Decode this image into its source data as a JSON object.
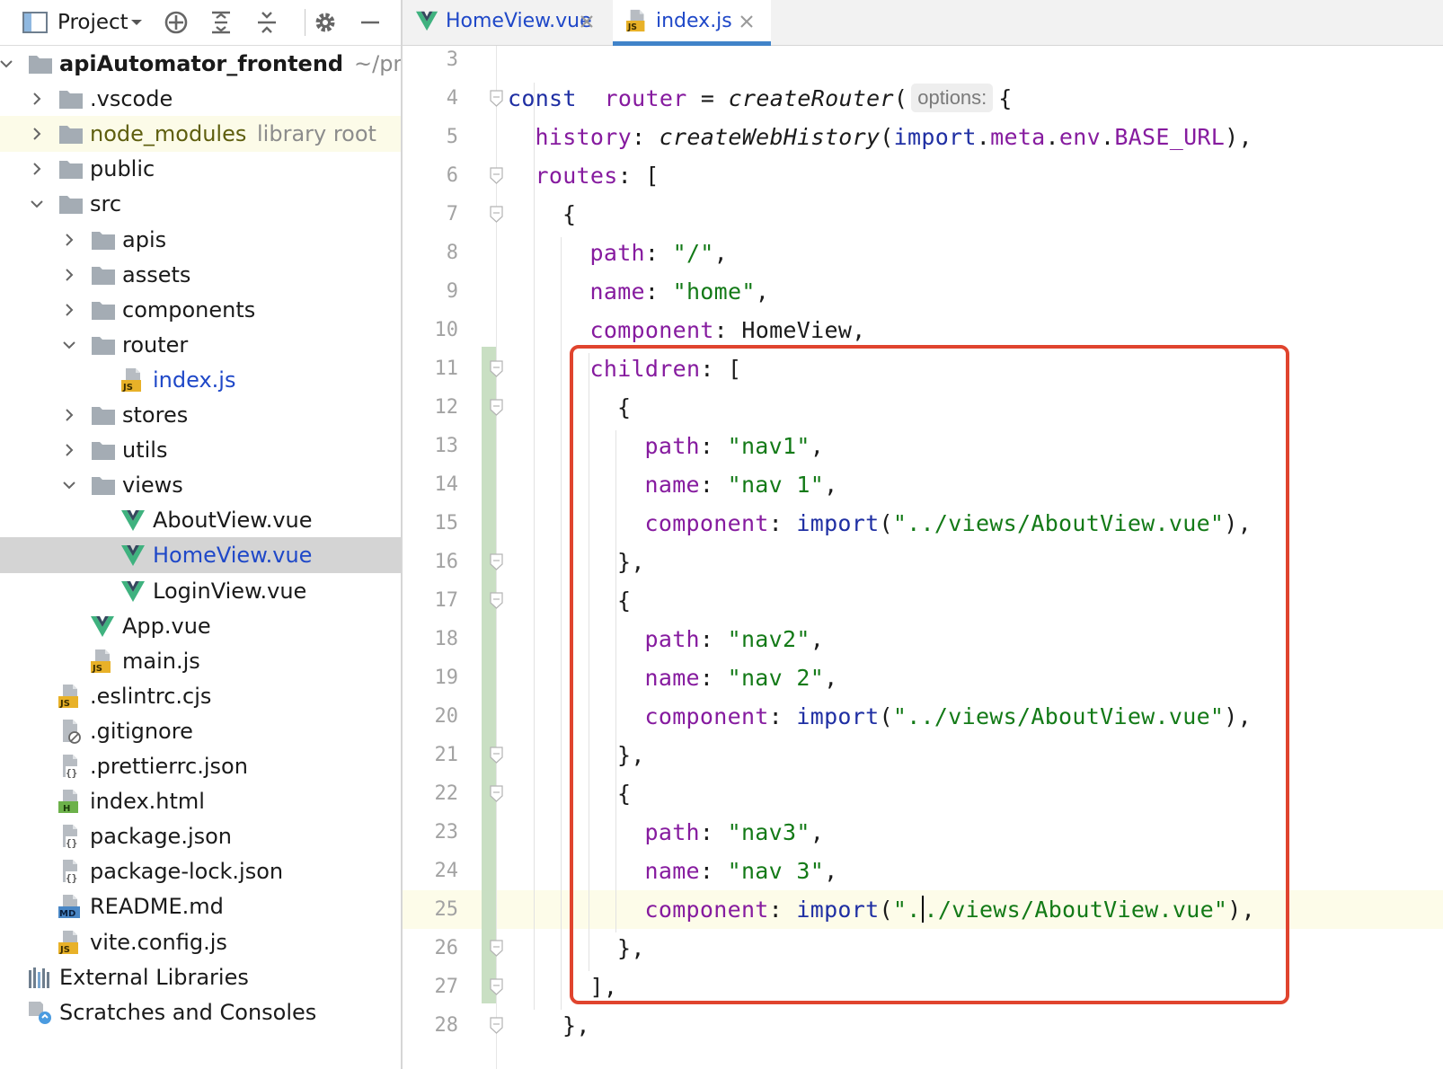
{
  "project_panel": {
    "title": "Project",
    "tree": [
      {
        "label": "apiAutomator_frontend",
        "hint": "~/projects/apiAutomator_frontend",
        "type": "folder",
        "depth": 0,
        "expanded": true,
        "bold": true
      },
      {
        "label": ".vscode",
        "type": "folder",
        "depth": 1,
        "expanded": false
      },
      {
        "label": "node_modules",
        "hint": "library root",
        "type": "folder",
        "depth": 1,
        "expanded": false,
        "library": true
      },
      {
        "label": "public",
        "type": "folder",
        "depth": 1,
        "expanded": false
      },
      {
        "label": "src",
        "type": "folder",
        "depth": 1,
        "expanded": true
      },
      {
        "label": "apis",
        "type": "folder",
        "depth": 2,
        "expanded": false
      },
      {
        "label": "assets",
        "type": "folder",
        "depth": 2,
        "expanded": false
      },
      {
        "label": "components",
        "type": "folder",
        "depth": 2,
        "expanded": false
      },
      {
        "label": "router",
        "type": "folder",
        "depth": 2,
        "expanded": true
      },
      {
        "label": "index.js",
        "type": "js",
        "depth": 3,
        "color": "blue"
      },
      {
        "label": "stores",
        "type": "folder",
        "depth": 2,
        "expanded": false
      },
      {
        "label": "utils",
        "type": "folder",
        "depth": 2,
        "expanded": false
      },
      {
        "label": "views",
        "type": "folder",
        "depth": 2,
        "expanded": true
      },
      {
        "label": "AboutView.vue",
        "type": "vue",
        "depth": 3
      },
      {
        "label": "HomeView.vue",
        "type": "vue",
        "depth": 3,
        "color": "blue",
        "selected": true
      },
      {
        "label": "LoginView.vue",
        "type": "vue",
        "depth": 3
      },
      {
        "label": "App.vue",
        "type": "vue",
        "depth": 2
      },
      {
        "label": "main.js",
        "type": "js",
        "depth": 2
      },
      {
        "label": ".eslintrc.cjs",
        "type": "js",
        "depth": 1
      },
      {
        "label": ".gitignore",
        "type": "ignore",
        "depth": 1
      },
      {
        "label": ".prettierrc.json",
        "type": "json",
        "depth": 1
      },
      {
        "label": "index.html",
        "type": "html",
        "depth": 1
      },
      {
        "label": "package.json",
        "type": "json",
        "depth": 1
      },
      {
        "label": "package-lock.json",
        "type": "json",
        "depth": 1
      },
      {
        "label": "README.md",
        "type": "md",
        "depth": 1
      },
      {
        "label": "vite.config.js",
        "type": "js",
        "depth": 1
      },
      {
        "label": "External Libraries",
        "type": "libraries",
        "depth": 0
      },
      {
        "label": "Scratches and Consoles",
        "type": "scratches",
        "depth": 0
      }
    ]
  },
  "editor": {
    "tabs": [
      {
        "label": "HomeView.vue",
        "type": "vue",
        "active": false
      },
      {
        "label": "index.js",
        "type": "js",
        "active": true
      }
    ],
    "caret_line": 25,
    "lines": [
      {
        "n": "3",
        "indent": 0,
        "fold": false,
        "tokens": []
      },
      {
        "n": "4",
        "indent": 0,
        "fold": true,
        "tokens": [
          [
            "kw",
            "const"
          ],
          [
            "",
            "  "
          ],
          [
            "prop",
            "router"
          ],
          [
            "",
            " = "
          ],
          [
            "fn",
            "createRouter"
          ],
          [
            "",
            "("
          ],
          [
            "hint",
            "options:"
          ],
          [
            "",
            "{"
          ]
        ]
      },
      {
        "n": "5",
        "indent": 1,
        "fold": false,
        "tokens": [
          [
            "prop",
            "history"
          ],
          [
            "",
            ": "
          ],
          [
            "fn",
            "createWebHistory"
          ],
          [
            "",
            "("
          ],
          [
            "kw",
            "import"
          ],
          [
            "",
            "."
          ],
          [
            "meta",
            "meta"
          ],
          [
            "",
            "."
          ],
          [
            "meta",
            "env"
          ],
          [
            "",
            "."
          ],
          [
            "meta",
            "BASE_URL"
          ],
          [
            "",
            "),"
          ]
        ]
      },
      {
        "n": "6",
        "indent": 1,
        "fold": true,
        "tokens": [
          [
            "prop",
            "routes"
          ],
          [
            "",
            ": ["
          ]
        ]
      },
      {
        "n": "7",
        "indent": 2,
        "fold": true,
        "tokens": [
          [
            "",
            "{"
          ]
        ]
      },
      {
        "n": "8",
        "indent": 3,
        "fold": false,
        "tokens": [
          [
            "prop",
            "path"
          ],
          [
            "",
            ": "
          ],
          [
            "str",
            "\"/\""
          ],
          [
            "",
            ","
          ]
        ]
      },
      {
        "n": "9",
        "indent": 3,
        "fold": false,
        "tokens": [
          [
            "prop",
            "name"
          ],
          [
            "",
            ": "
          ],
          [
            "str",
            "\"home\""
          ],
          [
            "",
            ","
          ]
        ]
      },
      {
        "n": "10",
        "indent": 3,
        "fold": false,
        "tokens": [
          [
            "prop",
            "component"
          ],
          [
            "",
            ": HomeView,"
          ]
        ]
      },
      {
        "n": "11",
        "indent": 3,
        "fold": true,
        "tokens": [
          [
            "prop",
            "children"
          ],
          [
            "",
            ": ["
          ]
        ]
      },
      {
        "n": "12",
        "indent": 4,
        "fold": true,
        "tokens": [
          [
            "",
            "{"
          ]
        ]
      },
      {
        "n": "13",
        "indent": 5,
        "fold": false,
        "tokens": [
          [
            "prop",
            "path"
          ],
          [
            "",
            ": "
          ],
          [
            "str",
            "\"nav1\""
          ],
          [
            "",
            ","
          ]
        ]
      },
      {
        "n": "14",
        "indent": 5,
        "fold": false,
        "tokens": [
          [
            "prop",
            "name"
          ],
          [
            "",
            ": "
          ],
          [
            "str",
            "\"nav 1\""
          ],
          [
            "",
            ","
          ]
        ]
      },
      {
        "n": "15",
        "indent": 5,
        "fold": false,
        "tokens": [
          [
            "prop",
            "component"
          ],
          [
            "",
            ": "
          ],
          [
            "kw",
            "import"
          ],
          [
            "",
            "("
          ],
          [
            "str",
            "\"../views/AboutView.vue\""
          ],
          [
            "",
            "),"
          ]
        ]
      },
      {
        "n": "16",
        "indent": 4,
        "fold": true,
        "tokens": [
          [
            "",
            "},"
          ]
        ]
      },
      {
        "n": "17",
        "indent": 4,
        "fold": true,
        "tokens": [
          [
            "",
            "{"
          ]
        ]
      },
      {
        "n": "18",
        "indent": 5,
        "fold": false,
        "tokens": [
          [
            "prop",
            "path"
          ],
          [
            "",
            ": "
          ],
          [
            "str",
            "\"nav2\""
          ],
          [
            "",
            ","
          ]
        ]
      },
      {
        "n": "19",
        "indent": 5,
        "fold": false,
        "tokens": [
          [
            "prop",
            "name"
          ],
          [
            "",
            ": "
          ],
          [
            "str",
            "\"nav 2\""
          ],
          [
            "",
            ","
          ]
        ]
      },
      {
        "n": "20",
        "indent": 5,
        "fold": false,
        "tokens": [
          [
            "prop",
            "component"
          ],
          [
            "",
            ": "
          ],
          [
            "kw",
            "import"
          ],
          [
            "",
            "("
          ],
          [
            "str",
            "\"../views/AboutView.vue\""
          ],
          [
            "",
            "),"
          ]
        ]
      },
      {
        "n": "21",
        "indent": 4,
        "fold": true,
        "tokens": [
          [
            "",
            "},"
          ]
        ]
      },
      {
        "n": "22",
        "indent": 4,
        "fold": true,
        "tokens": [
          [
            "",
            "{"
          ]
        ]
      },
      {
        "n": "23",
        "indent": 5,
        "fold": false,
        "tokens": [
          [
            "prop",
            "path"
          ],
          [
            "",
            ": "
          ],
          [
            "str",
            "\"nav3\""
          ],
          [
            "",
            ","
          ]
        ]
      },
      {
        "n": "24",
        "indent": 5,
        "fold": false,
        "tokens": [
          [
            "prop",
            "name"
          ],
          [
            "",
            ": "
          ],
          [
            "str",
            "\"nav 3\""
          ],
          [
            "",
            ","
          ]
        ]
      },
      {
        "n": "25",
        "indent": 5,
        "fold": false,
        "tokens": [
          [
            "prop",
            "component"
          ],
          [
            "",
            ": "
          ],
          [
            "kw",
            "import"
          ],
          [
            "",
            "("
          ],
          [
            "str",
            "\"."
          ],
          [
            "cursor",
            ""
          ],
          [
            "str",
            "./views/AboutView.vue\""
          ],
          [
            "",
            "),"
          ]
        ]
      },
      {
        "n": "26",
        "indent": 4,
        "fold": true,
        "tokens": [
          [
            "",
            "},"
          ]
        ]
      },
      {
        "n": "27",
        "indent": 3,
        "fold": true,
        "tokens": [
          [
            "",
            "],"
          ]
        ]
      },
      {
        "n": "28",
        "indent": 2,
        "fold": true,
        "tokens": [
          [
            "",
            "},"
          ]
        ]
      }
    ]
  },
  "colors": {
    "keyword": "#1f2fa3",
    "property": "#861b9f",
    "string": "#137a17",
    "highlight_box": "#e0442e",
    "vue_green": "#3fb27f",
    "vue_dark": "#35495e",
    "js_badge": "#e8b128",
    "selected_row": "#d4d4d4"
  }
}
